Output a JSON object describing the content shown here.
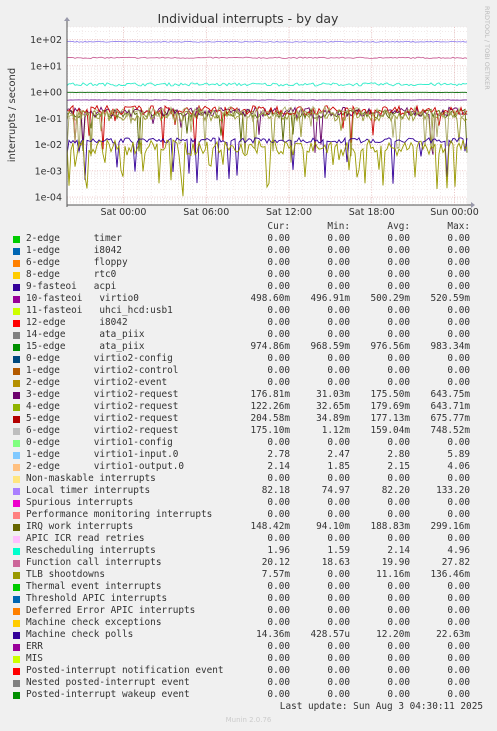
{
  "chart_data": {
    "type": "line",
    "title": "Individual interrupts - by day",
    "ylabel": "interrupts / second",
    "yscale": "log",
    "ylim": [
      5e-05,
      300
    ],
    "y_ticks": [
      "1e+02",
      "1e+01",
      "1e+00",
      "1e-01",
      "1e-02",
      "1e-03",
      "1e-04"
    ],
    "x_ticks": [
      "Sat 00:00",
      "Sat 06:00",
      "Sat 12:00",
      "Sat 18:00",
      "Sun 00:00"
    ],
    "side_text": "RRDTOOL / TOBI OETIKER",
    "grid": true,
    "series_traces": [
      {
        "name": "10-fasteoi virtio0",
        "level": 0.4983,
        "noise": 0.02,
        "color": "#7a2a9c",
        "dips": 0.0
      },
      {
        "name": "Function call interrupts",
        "level": 20.12,
        "noise": 0.05,
        "color": "#cc6699",
        "dips": 0.0
      },
      {
        "name": "Rescheduling interrupts",
        "level": 1.96,
        "noise": 0.12,
        "color": "#33eecc",
        "dips": 0.0
      },
      {
        "name": "Local timer interrupts",
        "level": 82.18,
        "noise": 0.04,
        "color": "#9988ee",
        "dips": 0.0
      },
      {
        "name": "15-edge ata_piix",
        "level": 0.97486,
        "noise": 0.005,
        "color": "#006600",
        "dips": 0.0
      },
      {
        "name": "IRQ work interrupts",
        "level": 0.14842,
        "noise": 0.35,
        "color": "#556600",
        "dips": 0.05
      },
      {
        "name": "3-edge virtio2-request",
        "level": 0.17681,
        "noise": 0.35,
        "color": "#660066",
        "dips": 0.05
      },
      {
        "name": "5-edge virtio2-request",
        "level": 0.20458,
        "noise": 0.35,
        "color": "#cc0000",
        "dips": 0.05
      },
      {
        "name": "4-edge virtio2-request",
        "level": 0.12226,
        "noise": 0.4,
        "color": "#999933",
        "dips": 0.08
      },
      {
        "name": "6-edge virtio2-request",
        "level": 0.1751,
        "noise": 0.4,
        "color": "#aaaa66",
        "dips": 0.1
      },
      {
        "name": "Machine check polls",
        "level": 0.01436,
        "noise": 0.2,
        "color": "#330099",
        "dips": 0.12
      },
      {
        "name": "TLB shootdowns",
        "level": 0.00757,
        "noise": 0.6,
        "color": "#999900",
        "dips": 0.15
      }
    ],
    "columns": [
      "Cur:",
      "Min:",
      "Avg:",
      "Max:"
    ],
    "series": [
      {
        "name": "2-edge      timer",
        "color": "#00cc00",
        "cur": "0.00",
        "min": "0.00",
        "avg": "0.00",
        "max": "0.00"
      },
      {
        "name": "1-edge      i8042",
        "color": "#0066b3",
        "cur": "0.00",
        "min": "0.00",
        "avg": "0.00",
        "max": "0.00"
      },
      {
        "name": "6-edge      floppy",
        "color": "#ff8000",
        "cur": "0.00",
        "min": "0.00",
        "avg": "0.00",
        "max": "0.00"
      },
      {
        "name": "8-edge      rtc0",
        "color": "#ffcc00",
        "cur": "0.00",
        "min": "0.00",
        "avg": "0.00",
        "max": "0.00"
      },
      {
        "name": "9-fasteoi   acpi",
        "color": "#330099",
        "cur": "0.00",
        "min": "0.00",
        "avg": "0.00",
        "max": "0.00"
      },
      {
        "name": "10-fasteoi   virtio0",
        "color": "#990099",
        "cur": "498.60m",
        "min": "496.91m",
        "avg": "500.29m",
        "max": "520.59m"
      },
      {
        "name": "11-fasteoi   uhci_hcd:usb1",
        "color": "#ccff00",
        "cur": "0.00",
        "min": "0.00",
        "avg": "0.00",
        "max": "0.00"
      },
      {
        "name": "12-edge      i8042",
        "color": "#ff0000",
        "cur": "0.00",
        "min": "0.00",
        "avg": "0.00",
        "max": "0.00"
      },
      {
        "name": "14-edge      ata_piix",
        "color": "#808080",
        "cur": "0.00",
        "min": "0.00",
        "avg": "0.00",
        "max": "0.00"
      },
      {
        "name": "15-edge      ata_piix",
        "color": "#008f00",
        "cur": "974.86m",
        "min": "968.59m",
        "avg": "976.56m",
        "max": "983.34m"
      },
      {
        "name": "0-edge      virtio2-config",
        "color": "#00487d",
        "cur": "0.00",
        "min": "0.00",
        "avg": "0.00",
        "max": "0.00"
      },
      {
        "name": "1-edge      virtio2-control",
        "color": "#b35a00",
        "cur": "0.00",
        "min": "0.00",
        "avg": "0.00",
        "max": "0.00"
      },
      {
        "name": "2-edge      virtio2-event",
        "color": "#b38f00",
        "cur": "0.00",
        "min": "0.00",
        "avg": "0.00",
        "max": "0.00"
      },
      {
        "name": "3-edge      virtio2-request",
        "color": "#6b006b",
        "cur": "176.81m",
        "min": "31.03m",
        "avg": "175.50m",
        "max": "643.75m"
      },
      {
        "name": "4-edge      virtio2-request",
        "color": "#8fb300",
        "cur": "122.26m",
        "min": "32.65m",
        "avg": "179.69m",
        "max": "643.71m"
      },
      {
        "name": "5-edge      virtio2-request",
        "color": "#b30000",
        "cur": "204.58m",
        "min": "34.89m",
        "avg": "177.13m",
        "max": "675.77m"
      },
      {
        "name": "6-edge      virtio2-request",
        "color": "#bebebe",
        "cur": "175.10m",
        "min": "1.12m",
        "avg": "159.04m",
        "max": "748.52m"
      },
      {
        "name": "0-edge      virtio1-config",
        "color": "#80ff80",
        "cur": "0.00",
        "min": "0.00",
        "avg": "0.00",
        "max": "0.00"
      },
      {
        "name": "1-edge      virtio1-input.0",
        "color": "#80c9ff",
        "cur": "2.78",
        "min": "2.47",
        "avg": "2.80",
        "max": "5.89"
      },
      {
        "name": "2-edge      virtio1-output.0",
        "color": "#ffc080",
        "cur": "2.14",
        "min": "1.85",
        "avg": "2.15",
        "max": "4.06"
      },
      {
        "name": "Non-maskable interrupts",
        "color": "#ffe680",
        "cur": "0.00",
        "min": "0.00",
        "avg": "0.00",
        "max": "0.00"
      },
      {
        "name": "Local timer interrupts",
        "color": "#aa80ff",
        "cur": "82.18",
        "min": "74.97",
        "avg": "82.20",
        "max": "133.20"
      },
      {
        "name": "Spurious interrupts",
        "color": "#ee00cc",
        "cur": "0.00",
        "min": "0.00",
        "avg": "0.00",
        "max": "0.00"
      },
      {
        "name": "Performance monitoring interrupts",
        "color": "#ff8080",
        "cur": "0.00",
        "min": "0.00",
        "avg": "0.00",
        "max": "0.00"
      },
      {
        "name": "IRQ work interrupts",
        "color": "#666600",
        "cur": "148.42m",
        "min": "94.10m",
        "avg": "188.83m",
        "max": "299.16m"
      },
      {
        "name": "APIC ICR read retries",
        "color": "#ffbfff",
        "cur": "0.00",
        "min": "0.00",
        "avg": "0.00",
        "max": "0.00"
      },
      {
        "name": "Rescheduling interrupts",
        "color": "#00ffcc",
        "cur": "1.96",
        "min": "1.59",
        "avg": "2.14",
        "max": "4.96"
      },
      {
        "name": "Function call interrupts",
        "color": "#cc6699",
        "cur": "20.12",
        "min": "18.63",
        "avg": "19.90",
        "max": "27.82"
      },
      {
        "name": "TLB shootdowns",
        "color": "#999900",
        "cur": "7.57m",
        "min": "0.00",
        "avg": "11.16m",
        "max": "136.46m"
      },
      {
        "name": "Thermal event interrupts",
        "color": "#00cc00",
        "cur": "0.00",
        "min": "0.00",
        "avg": "0.00",
        "max": "0.00"
      },
      {
        "name": "Threshold APIC interrupts",
        "color": "#0066b3",
        "cur": "0.00",
        "min": "0.00",
        "avg": "0.00",
        "max": "0.00"
      },
      {
        "name": "Deferred Error APIC interrupts",
        "color": "#ff8000",
        "cur": "0.00",
        "min": "0.00",
        "avg": "0.00",
        "max": "0.00"
      },
      {
        "name": "Machine check exceptions",
        "color": "#ffcc00",
        "cur": "0.00",
        "min": "0.00",
        "avg": "0.00",
        "max": "0.00"
      },
      {
        "name": "Machine check polls",
        "color": "#330099",
        "cur": "14.36m",
        "min": "428.57u",
        "avg": "12.20m",
        "max": "22.63m"
      },
      {
        "name": "ERR",
        "color": "#990099",
        "cur": "0.00",
        "min": "0.00",
        "avg": "0.00",
        "max": "0.00"
      },
      {
        "name": "MIS",
        "color": "#ccff00",
        "cur": "0.00",
        "min": "0.00",
        "avg": "0.00",
        "max": "0.00"
      },
      {
        "name": "Posted-interrupt notification event",
        "color": "#ff0000",
        "cur": "0.00",
        "min": "0.00",
        "avg": "0.00",
        "max": "0.00"
      },
      {
        "name": "Nested posted-interrupt event",
        "color": "#808080",
        "cur": "0.00",
        "min": "0.00",
        "avg": "0.00",
        "max": "0.00"
      },
      {
        "name": "Posted-interrupt wakeup event",
        "color": "#008f00",
        "cur": "0.00",
        "min": "0.00",
        "avg": "0.00",
        "max": "0.00"
      }
    ],
    "last_update": "Last update: Sun Aug  3 04:30:11 2025",
    "footer": "Munin 2.0.76"
  }
}
